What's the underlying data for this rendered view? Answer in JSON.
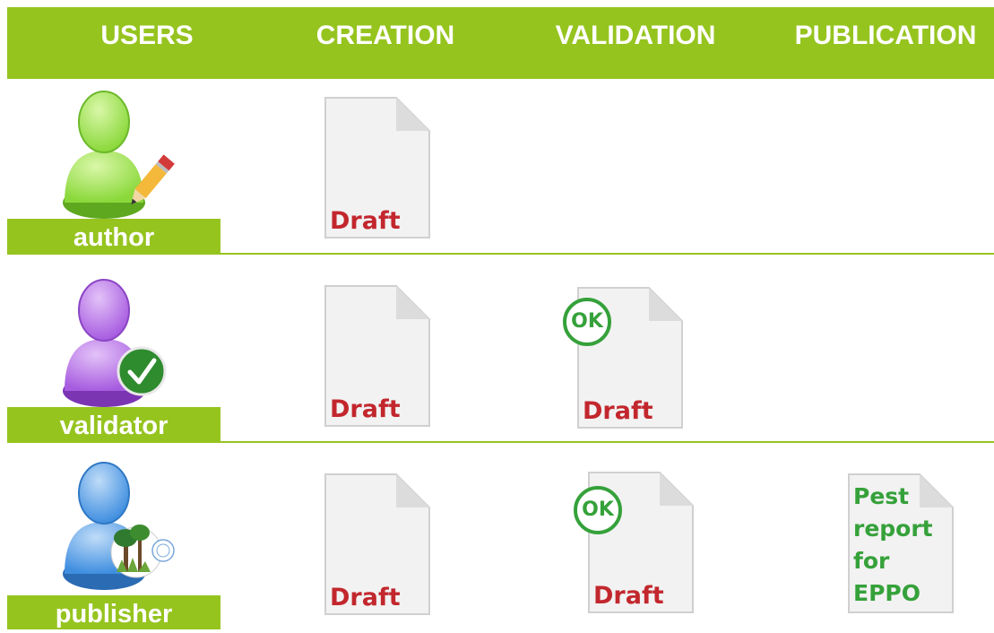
{
  "header": {
    "users": "USERS",
    "creation": "CREATION",
    "validation": "VALIDATION",
    "publication": "PUBLICATION"
  },
  "rows": [
    {
      "user_label": "author",
      "user_color": "#8ad83a",
      "badge": "pencil-icon"
    },
    {
      "user_label": "validator",
      "user_color": "#a75ce0",
      "badge": "check-badge-icon"
    },
    {
      "user_label": "publisher",
      "user_color": "#3f8ee0",
      "badge": "eppo-logo"
    }
  ],
  "documents": {
    "draft_label": "Draft",
    "ok_label": "OK",
    "publication_label": "Pest\nreport\nfor\nEPPO"
  },
  "colors": {
    "accent_green": "#96c41f",
    "draft_red": "#c2272d",
    "ok_green": "#35a13a"
  }
}
